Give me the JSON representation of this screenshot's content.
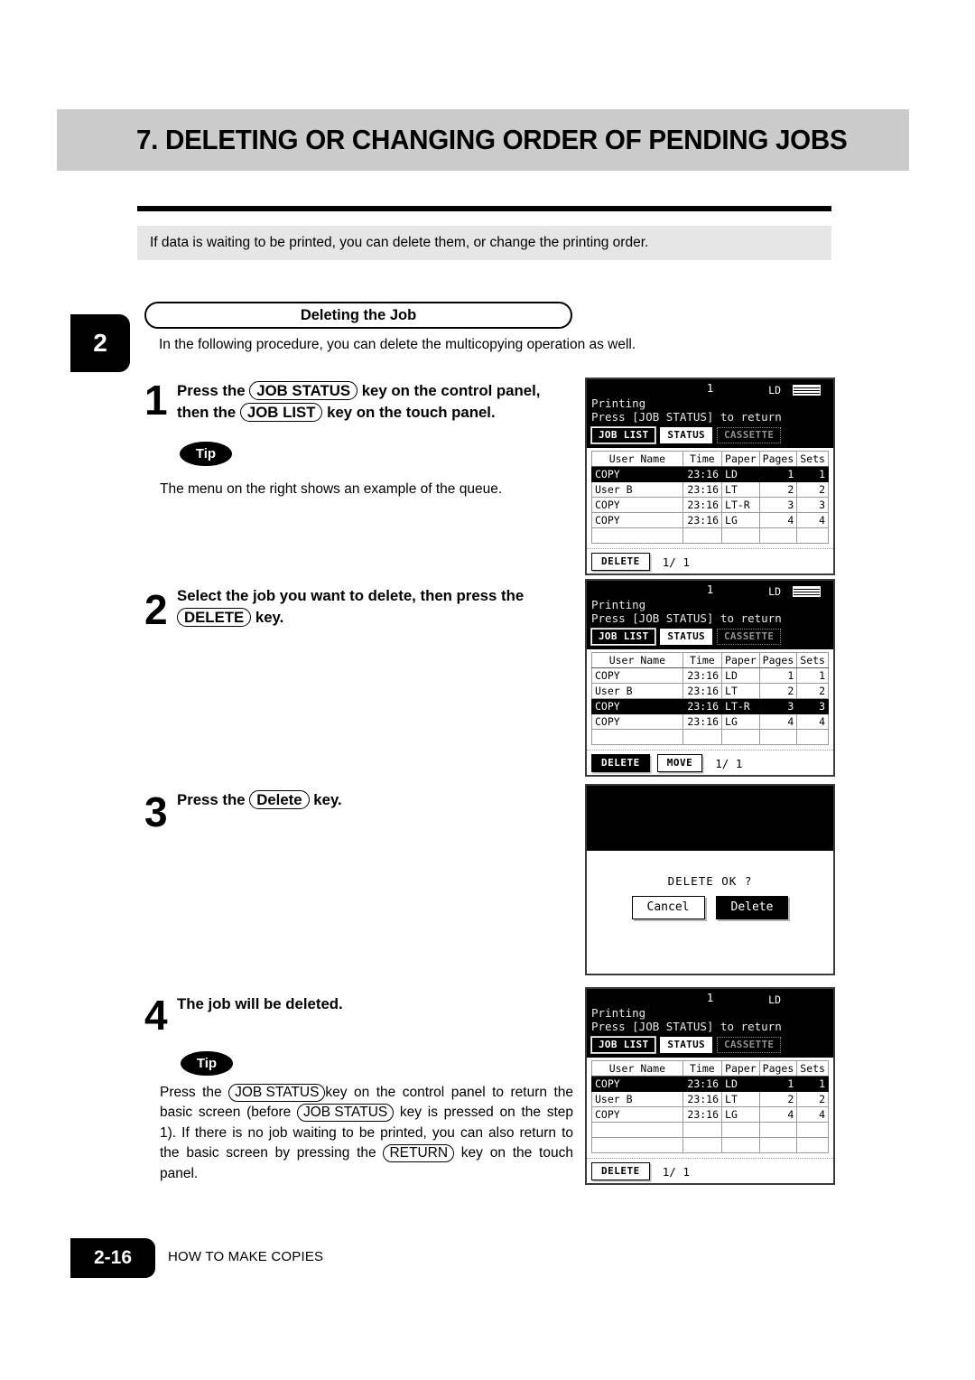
{
  "header": {
    "title": "7. DELETING OR CHANGING ORDER OF PENDING JOBS"
  },
  "intro": {
    "text": "If data is waiting to be printed, you can delete them, or change the printing order."
  },
  "chapter_tab": {
    "number": "2"
  },
  "section": {
    "caption": "Deleting the Job",
    "lead": "In the following procedure, you can delete the multicopying operation as well."
  },
  "steps": [
    {
      "number": "1",
      "text_parts": [
        "Press the ",
        "JOB STATUS",
        " key on the control panel, then the ",
        "JOB LIST",
        " key on the touch panel."
      ],
      "key1": "JOB STATUS",
      "key2": "JOB LIST",
      "before_key1": "Press the ",
      "between": " key on the control panel,",
      "line2_before": "then the ",
      "line2_after": " key on the touch panel."
    },
    {
      "number": "2",
      "line1": "Select the job you want to delete, then press the",
      "key": "DELETE",
      "line2_after": " key."
    },
    {
      "number": "3",
      "before": "Press the ",
      "key": "Delete",
      "after": " key."
    },
    {
      "number": "4",
      "text": "The job will be deleted."
    }
  ],
  "tips": [
    {
      "label": "Tip",
      "text": "The menu on the right shows an example of the queue."
    },
    {
      "label": "Tip",
      "seg1": "Press the ",
      "key1": "JOB STATUS",
      "seg2": "key on the control panel to return the basic screen (before ",
      "key2": "JOB STATUS",
      "seg3": " key is pressed on the step 1).  If there is no job waiting to be printed, you can also return to the basic screen by pressing the ",
      "key3": "RETURN",
      "seg4": " key on the touch panel."
    }
  ],
  "panels": [
    {
      "name": "job-list-initial",
      "page_indicator": "1",
      "paper_size": "LD",
      "has_paper_icon": true,
      "status_line": "Printing",
      "return_line": "Press [JOB STATUS] to return",
      "tabs": [
        {
          "label": "JOB LIST",
          "state": "selected"
        },
        {
          "label": "STATUS",
          "state": "unselected"
        },
        {
          "label": "CASSETTE",
          "state": "disabled"
        }
      ],
      "columns": [
        "User Name",
        "Time",
        "Paper",
        "Pages",
        "Sets"
      ],
      "rows": [
        {
          "user": "COPY",
          "time": "23:16",
          "paper": "LD",
          "pages": "1",
          "sets": "1",
          "highlight": true
        },
        {
          "user": "User B",
          "time": "23:16",
          "paper": "LT",
          "pages": "2",
          "sets": "2",
          "highlight": false
        },
        {
          "user": "COPY",
          "time": "23:16",
          "paper": "LT-R",
          "pages": "3",
          "sets": "3",
          "highlight": false
        },
        {
          "user": "COPY",
          "time": "23:16",
          "paper": "LG",
          "pages": "4",
          "sets": "4",
          "highlight": false
        }
      ],
      "empty_rows": 1,
      "buttons": [
        {
          "label": "DELETE",
          "state": "normal"
        }
      ],
      "page_count": "1/ 1"
    },
    {
      "name": "job-list-selected",
      "page_indicator": "1",
      "paper_size": "LD",
      "has_paper_icon": true,
      "status_line": "Printing",
      "return_line": "Press [JOB STATUS] to return",
      "tabs": [
        {
          "label": "JOB LIST",
          "state": "selected"
        },
        {
          "label": "STATUS",
          "state": "unselected"
        },
        {
          "label": "CASSETTE",
          "state": "disabled"
        }
      ],
      "columns": [
        "User Name",
        "Time",
        "Paper",
        "Pages",
        "Sets"
      ],
      "rows": [
        {
          "user": "COPY",
          "time": "23:16",
          "paper": "LD",
          "pages": "1",
          "sets": "1",
          "highlight": false
        },
        {
          "user": "User B",
          "time": "23:16",
          "paper": "LT",
          "pages": "2",
          "sets": "2",
          "highlight": false
        },
        {
          "user": "COPY",
          "time": "23:16",
          "paper": "LT-R",
          "pages": "3",
          "sets": "3",
          "highlight": true
        },
        {
          "user": "COPY",
          "time": "23:16",
          "paper": "LG",
          "pages": "4",
          "sets": "4",
          "highlight": false
        }
      ],
      "empty_rows": 1,
      "buttons": [
        {
          "label": "DELETE",
          "state": "dark"
        },
        {
          "label": "MOVE",
          "state": "normal"
        }
      ],
      "page_count": "1/ 1"
    },
    {
      "name": "delete-confirm",
      "message": "DELETE OK ?",
      "buttons": [
        {
          "label": "Cancel",
          "state": "normal"
        },
        {
          "label": "Delete",
          "state": "dark"
        }
      ]
    },
    {
      "name": "job-list-after-delete",
      "page_indicator": "1",
      "paper_size": "LD",
      "has_paper_icon": false,
      "status_line": "Printing",
      "return_line": "Press [JOB STATUS] to return",
      "tabs": [
        {
          "label": "JOB LIST",
          "state": "selected"
        },
        {
          "label": "STATUS",
          "state": "unselected"
        },
        {
          "label": "CASSETTE",
          "state": "disabled"
        }
      ],
      "columns": [
        "User Name",
        "Time",
        "Paper",
        "Pages",
        "Sets"
      ],
      "rows": [
        {
          "user": "COPY",
          "time": "23:16",
          "paper": "LD",
          "pages": "1",
          "sets": "1",
          "highlight": true
        },
        {
          "user": "User B",
          "time": "23:16",
          "paper": "LT",
          "pages": "2",
          "sets": "2",
          "highlight": false
        },
        {
          "user": "COPY",
          "time": "23:16",
          "paper": "LG",
          "pages": "4",
          "sets": "4",
          "highlight": false
        }
      ],
      "empty_rows": 2,
      "buttons": [
        {
          "label": "DELETE",
          "state": "normal"
        }
      ],
      "page_count": "1/ 1"
    }
  ],
  "footer": {
    "page_number": "2-16",
    "chapter_name": "HOW TO MAKE COPIES"
  }
}
